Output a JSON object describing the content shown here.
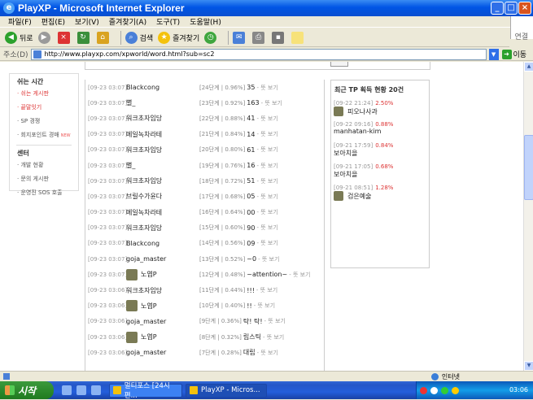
{
  "window": {
    "title": "PlayXP - Microsoft Internet Explorer"
  },
  "menu": [
    "파일(F)",
    "편집(E)",
    "보기(V)",
    "즐겨찾기(A)",
    "도구(T)",
    "도움말(H)"
  ],
  "toolbar": {
    "back": "뒤로",
    "search": "검색",
    "favorites": "즐겨찾기",
    "links": "연결"
  },
  "address": {
    "label": "주소(D)",
    "url": "http://www.playxp.com/xpworld/word.html?sub=sc2",
    "go": "이동"
  },
  "sidebar": {
    "section1_title": "쉬는 시간",
    "section1_items": [
      "쉬는 게시판",
      "끝말잇기",
      "SP 경쟁",
      "회지포인트 경매"
    ],
    "new_badge": "NEW",
    "section2_title": "센터",
    "section2_items": [
      "개발 현황",
      "문의 게시판",
      "운영진 SOS 호출"
    ]
  },
  "words": [
    {
      "date": "[09-23 03:07]",
      "nick": "Blackcong",
      "level": "[24단계 | 0.96%]",
      "word": "35",
      "more": "- 뜻 보기",
      "avatar": false
    },
    {
      "date": "[09-23 03:07]",
      "nick": "별_",
      "level": "[23단계 | 0.92%]",
      "word": "163",
      "more": "- 뜻 보기",
      "avatar": false
    },
    {
      "date": "[09-23 03:07]",
      "nick": "워크초자임당",
      "level": "[22단계 | 0.88%]",
      "word": "41",
      "more": "- 뜻 보기",
      "avatar": false
    },
    {
      "date": "[09-23 03:07]",
      "nick": "메일녹차라테",
      "level": "[21단계 | 0.84%]",
      "word": "14",
      "more": "- 뜻 보기",
      "avatar": false
    },
    {
      "date": "[09-23 03:07]",
      "nick": "워크초자임당",
      "level": "[20단계 | 0.80%]",
      "word": "61",
      "more": "- 뜻 보기",
      "avatar": false
    },
    {
      "date": "[09-23 03:07]",
      "nick": "별_",
      "level": "[19단계 | 0.76%]",
      "word": "16",
      "more": "- 뜻 보기",
      "avatar": false
    },
    {
      "date": "[09-23 03:07]",
      "nick": "워크초자임당",
      "level": "[18단계 | 0.72%]",
      "word": "51",
      "more": "- 뜻 보기",
      "avatar": false
    },
    {
      "date": "[09-23 03:07]",
      "nick": "브릴수가윤다",
      "level": "[17단계 | 0.68%]",
      "word": "05",
      "more": "- 뜻 보기",
      "avatar": false
    },
    {
      "date": "[09-23 03:07]",
      "nick": "메일녹차라테",
      "level": "[16단계 | 0.64%]",
      "word": "00",
      "more": "- 뜻 보기",
      "avatar": false
    },
    {
      "date": "[09-23 03:07]",
      "nick": "워크초자임당",
      "level": "[15단계 | 0.60%]",
      "word": "90",
      "more": "- 뜻 보기",
      "avatar": false
    },
    {
      "date": "[09-23 03:07]",
      "nick": "Blackcong",
      "level": "[14단계 | 0.56%]",
      "word": "09",
      "more": "- 뜻 보기",
      "avatar": false
    },
    {
      "date": "[09-23 03:07]",
      "nick": "goja_master",
      "level": "[13단계 | 0.52%]",
      "word": "~0",
      "more": "- 뜻 보기",
      "avatar": false
    },
    {
      "date": "[09-23 03:07]",
      "nick": "노엽P",
      "level": "[12단계 | 0.48%]",
      "word": "~attention~",
      "more": "- 뜻 보기",
      "avatar": true
    },
    {
      "date": "[09-23 03:06]",
      "nick": "워크초자임당",
      "level": "[11단계 | 0.44%]",
      "word": "!!!",
      "more": "- 뜻 보기",
      "avatar": false
    },
    {
      "date": "[09-23 03:06]",
      "nick": "노엽P",
      "level": "[10단계 | 0.40%]",
      "word": "!!",
      "more": "- 뜻 보기",
      "avatar": true
    },
    {
      "date": "[09-23 03:06]",
      "nick": "goja_master",
      "level": "[9단계 | 0.36%]",
      "word": "탁! 탁!",
      "more": "- 뜻 보기",
      "avatar": false
    },
    {
      "date": "[09-23 03:06]",
      "nick": "노엽P",
      "level": "[8단계 | 0.32%]",
      "word": "립스틱",
      "more": "- 뜻 보기",
      "avatar": true
    },
    {
      "date": "[09-23 03:06]",
      "nick": "goja_master",
      "level": "[7단계 | 0.28%]",
      "word": "대립",
      "more": "- 뜻 보기",
      "avatar": false
    }
  ],
  "tp": {
    "title": "최근 TP 획득 현황 20건",
    "items": [
      {
        "time": "[09-22 21:24]",
        "pct": "2.50%",
        "name": "피오나사과",
        "avatar": true
      },
      {
        "time": "[09-22 09:16]",
        "pct": "0.88%",
        "name": "manhatan-kim",
        "avatar": false
      },
      {
        "time": "[09-21 17:59]",
        "pct": "0.84%",
        "name": "보아치을",
        "avatar": false
      },
      {
        "time": "[09-21 17:05]",
        "pct": "0.68%",
        "name": "보아치을",
        "avatar": false
      },
      {
        "time": "[09-21 08:51]",
        "pct": "1.28%",
        "name": "검은예술",
        "avatar": true
      }
    ]
  },
  "status": {
    "zone": "인터넷"
  },
  "taskbar": {
    "start": "시작",
    "tasks": [
      "멀티포스 [24시편...",
      "PlayXP - Micros..."
    ],
    "clock": "03:06"
  }
}
